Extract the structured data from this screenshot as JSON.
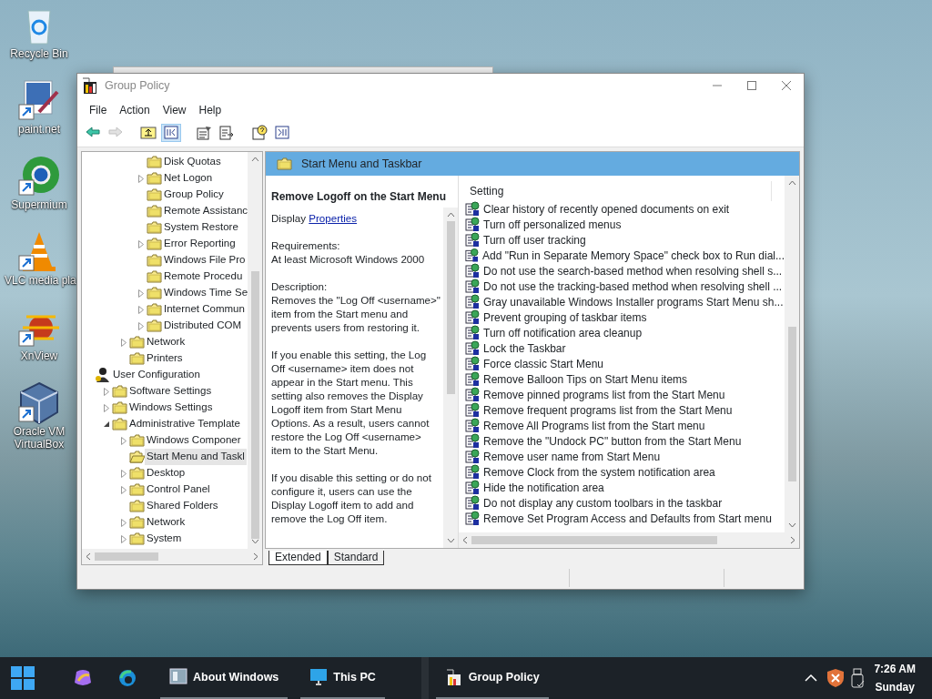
{
  "desktop_icons": [
    {
      "kind": "recycle",
      "label": "Recycle Bin",
      "shortcut": false
    },
    {
      "kind": "paint",
      "label": "paint.net",
      "shortcut": true
    },
    {
      "kind": "browser",
      "label": "Supermium",
      "shortcut": true
    },
    {
      "kind": "vlc",
      "label": "VLC media pla",
      "shortcut": true
    },
    {
      "kind": "xnview",
      "label": "XnView",
      "shortcut": true
    },
    {
      "kind": "vbox",
      "label": "Oracle VM VirtualBox",
      "shortcut": true
    }
  ],
  "window": {
    "title": "Group Policy",
    "active": false
  },
  "menu": [
    "File",
    "Action",
    "View",
    "Help"
  ],
  "toolbar": [
    {
      "kind": "back",
      "disabled": false,
      "pressed": false
    },
    {
      "kind": "forward",
      "disabled": true,
      "pressed": false
    },
    {
      "kind": "up",
      "disabled": false,
      "pressed": false
    },
    {
      "kind": "tree",
      "disabled": false,
      "pressed": true
    },
    {
      "kind": "properties",
      "disabled": false,
      "pressed": false
    },
    {
      "kind": "export",
      "disabled": false,
      "pressed": false
    },
    {
      "kind": "help",
      "disabled": false,
      "pressed": false
    },
    {
      "kind": "actionpane",
      "disabled": false,
      "pressed": false
    }
  ],
  "tree": [
    {
      "children": [
        {
          "children": [
            {
              "children": [
                {
                  "kind": "folder",
                  "label": "Disk Quotas",
                  "expandable": false,
                  "selected": false
                },
                {
                  "kind": "folder",
                  "label": "Net Logon",
                  "expandable": true,
                  "expanded": false,
                  "selected": false
                },
                {
                  "kind": "folder",
                  "label": "Group Policy",
                  "expandable": false,
                  "selected": false
                },
                {
                  "kind": "folder",
                  "label": "Remote Assistanc",
                  "expandable": false,
                  "selected": false
                },
                {
                  "kind": "folder",
                  "label": "System Restore",
                  "expandable": false,
                  "selected": false
                },
                {
                  "kind": "folder",
                  "label": "Error Reporting",
                  "expandable": true,
                  "expanded": false,
                  "selected": false
                },
                {
                  "kind": "folder",
                  "label": "Windows File Pro",
                  "expandable": false,
                  "selected": false
                },
                {
                  "kind": "folder",
                  "label": "Remote Procedu",
                  "expandable": false,
                  "selected": false
                },
                {
                  "kind": "folder",
                  "label": "Windows Time Se",
                  "expandable": true,
                  "expanded": false,
                  "selected": false
                },
                {
                  "kind": "folder",
                  "label": "Internet Commun",
                  "expandable": true,
                  "expanded": false,
                  "selected": false
                },
                {
                  "kind": "folder",
                  "label": "Distributed COM",
                  "expandable": true,
                  "expanded": false,
                  "selected": false
                }
              ]
            },
            {
              "kind": "folder",
              "label": "Network",
              "expandable": true,
              "expanded": false,
              "selected": false
            },
            {
              "kind": "folder",
              "label": "Printers",
              "expandable": false,
              "selected": false
            }
          ]
        }
      ]
    },
    {
      "kind": "user",
      "label": "User Configuration",
      "expandable": false,
      "selected": false,
      "children": [
        {
          "kind": "folder",
          "label": "Software Settings",
          "expandable": true,
          "expanded": false,
          "selected": false
        },
        {
          "kind": "folder",
          "label": "Windows Settings",
          "expandable": true,
          "expanded": false,
          "selected": false
        },
        {
          "kind": "folder",
          "label": "Administrative Template",
          "expandable": true,
          "expanded": true,
          "selected": false,
          "children": [
            {
              "kind": "folder",
              "label": "Windows Componer",
              "expandable": true,
              "expanded": false,
              "selected": false
            },
            {
              "kind": "open-folder",
              "label": "Start Menu and Taskl",
              "expandable": false,
              "selected": true
            },
            {
              "kind": "folder",
              "label": "Desktop",
              "expandable": true,
              "expanded": false,
              "selected": false
            },
            {
              "kind": "folder",
              "label": "Control Panel",
              "expandable": true,
              "expanded": false,
              "selected": false
            },
            {
              "kind": "folder",
              "label": "Shared Folders",
              "expandable": false,
              "selected": false
            },
            {
              "kind": "folder",
              "label": "Network",
              "expandable": true,
              "expanded": false,
              "selected": false
            },
            {
              "kind": "folder",
              "label": "System",
              "expandable": true,
              "expanded": false,
              "selected": false
            }
          ]
        }
      ]
    }
  ],
  "header": {
    "title": "Start Menu and Taskbar"
  },
  "description": {
    "title": "Remove Logoff on the Start Menu",
    "display_prefix": "Display",
    "link": "Properties",
    "requirements_label": "Requirements:",
    "requirements": "At least Microsoft Windows 2000",
    "description_label": "Description:",
    "paragraphs": [
      "Removes the \"Log Off <username>\" item from the Start menu and prevents users from restoring it.",
      "If you enable this setting, the Log Off <username> item does not appear in the Start menu. This setting also removes the Display Logoff item from Start Menu Options. As a result, users cannot restore the Log Off <username> item to the Start Menu.",
      "If you disable this setting or do not configure it, users can use the Display Logoff item to add and remove the Log Off item."
    ]
  },
  "settings": {
    "column": "Setting",
    "rows": [
      "Clear history of recently opened documents on exit",
      "Turn off personalized menus",
      "Turn off user tracking",
      "Add \"Run in Separate Memory Space\" check box to Run dial...",
      "Do not use the search-based method when resolving shell s...",
      "Do not use the tracking-based method when resolving shell ...",
      "Gray unavailable Windows Installer programs Start Menu sh...",
      "Prevent grouping of taskbar items",
      "Turn off notification area cleanup",
      "Lock the Taskbar",
      "Force classic Start Menu",
      "Remove Balloon Tips on Start Menu items",
      "Remove pinned programs list from the Start Menu",
      "Remove frequent programs list from the Start Menu",
      "Remove All Programs list from the Start menu",
      "Remove the \"Undock PC\" button from the Start Menu",
      "Remove user name from Start Menu",
      "Remove Clock from the system notification area",
      "Hide the notification area",
      "Do not display any custom toolbars in the taskbar",
      "Remove Set Program Access and Defaults from Start menu"
    ]
  },
  "tabs": [
    {
      "label": "Extended",
      "selected": true
    },
    {
      "label": "Standard",
      "selected": false
    }
  ],
  "taskbar": {
    "windows": [
      {
        "kind": "about",
        "label": "About Windows"
      },
      {
        "kind": "pc",
        "label": "This PC"
      },
      {
        "kind": "gp",
        "label": "Group Policy"
      }
    ],
    "time": "7:26 AM",
    "day": "Sunday"
  }
}
